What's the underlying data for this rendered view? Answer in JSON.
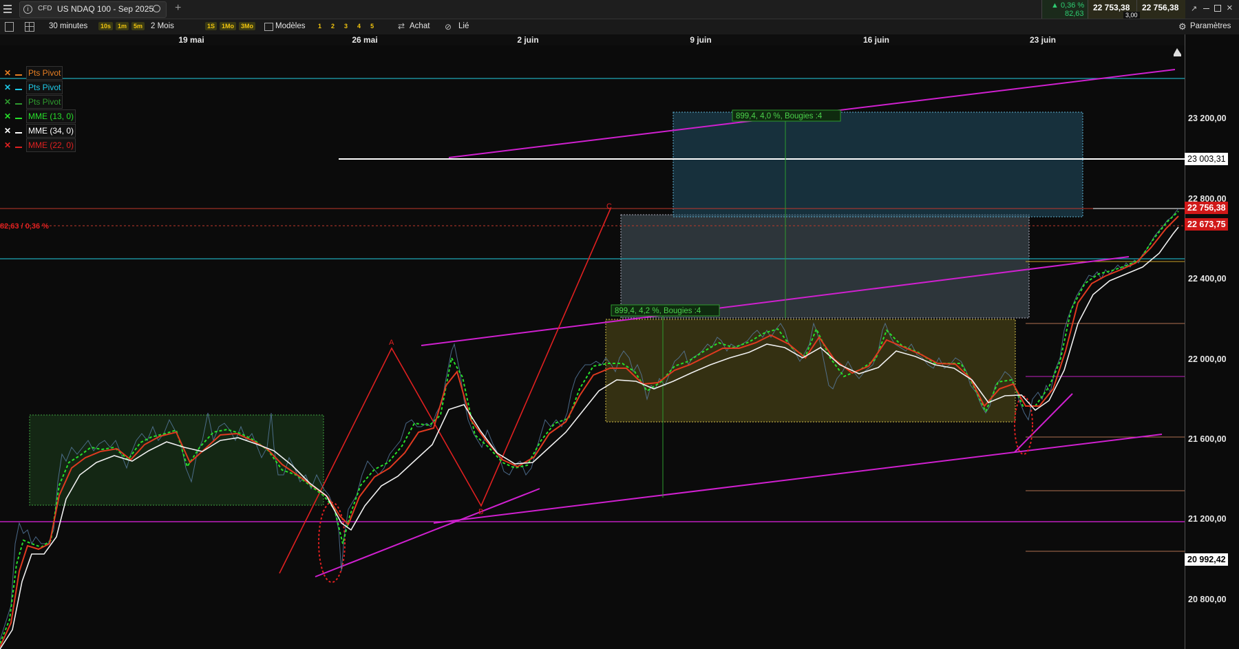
{
  "toolbar": {
    "menu_icon": "hamburger-icon",
    "instrument_type": "CFD",
    "instrument_name": "US NDAQ 100 - Sep 2025",
    "add_tab": "+",
    "interval": "30 minutes",
    "quick_intervals": [
      "10s",
      "1m",
      "5m"
    ],
    "period": "2 Mois",
    "quick_periods": [
      "1S",
      "1Mo",
      "3Mo"
    ],
    "templates_label": "Modèles",
    "presets": [
      "1",
      "2",
      "3",
      "4",
      "5"
    ],
    "buy_label": "Achat",
    "linked_label": "Lié",
    "settings_label": "Paramètres"
  },
  "quote": {
    "change_pct": "▲ 0,36 %",
    "change_abs": "82,63",
    "bid": "22 753,38",
    "ask": "22 756,38",
    "spread": "3,00"
  },
  "dates": [
    "19 mai",
    "26 mai",
    "2 juin",
    "9 juin",
    "16 juin",
    "23 juin"
  ],
  "price_axis": [
    "23 200,00",
    "22 800,00",
    "22 400,00",
    "22 000,00",
    "21 600,00",
    "21 200,00",
    "20 800,00"
  ],
  "price_tags": {
    "level_white": "23 003,31",
    "current": "22 756,38",
    "prev_close": "22 673,75",
    "low_level": "20 992,42"
  },
  "change_line_label": "82,63 / 0,36 %",
  "legend": [
    {
      "name": "Pts Pivot",
      "color": "#e67e22"
    },
    {
      "name": "Pts Pivot",
      "color": "#1ec8e6"
    },
    {
      "name": "Pts Pivot",
      "color": "#2e9b2e"
    },
    {
      "name": "MME (13, 0)",
      "color": "#27e02a"
    },
    {
      "name": "MME (34, 0)",
      "color": "#ffffff"
    },
    {
      "name": "MME (22, 0)",
      "color": "#e02020"
    }
  ],
  "annotations": {
    "measure_1": "899,4, 4,2 %, Bougies :4",
    "measure_2": "899,4, 4,0 %, Bougies :4",
    "wave_a": "A",
    "wave_b": "B",
    "wave_c": "C"
  }
}
